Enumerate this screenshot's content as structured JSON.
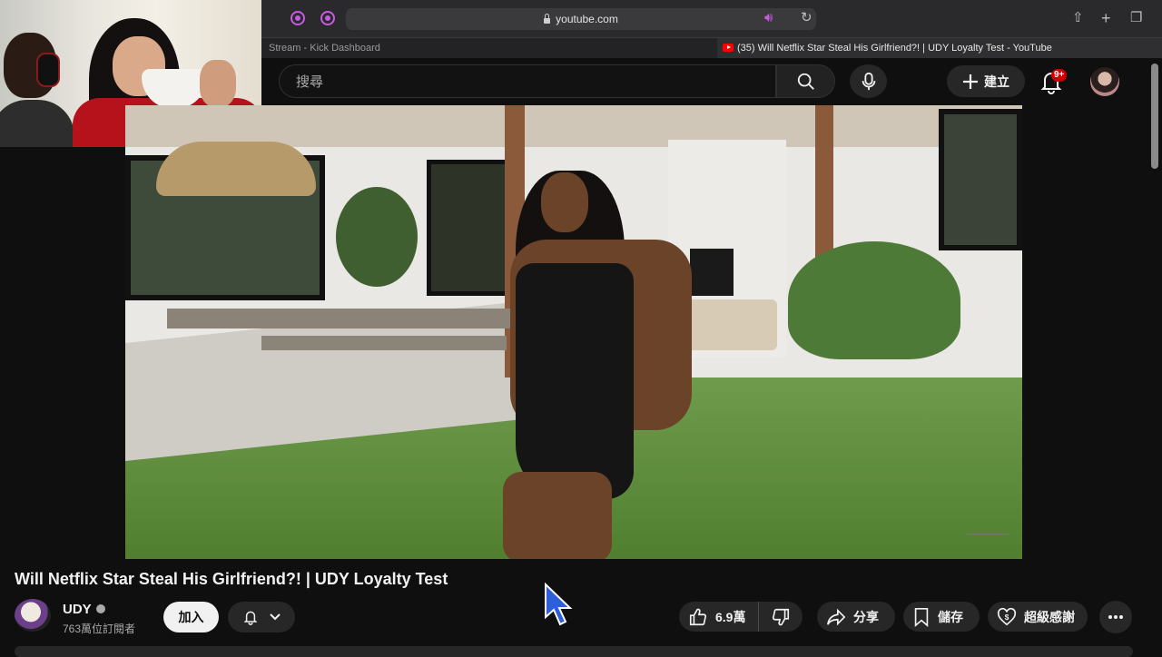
{
  "browser": {
    "url": "youtube.com",
    "tabs": [
      {
        "title": "Stream - Kick Dashboard",
        "active": false
      },
      {
        "title": "(35) Will Netflix Star Steal His Girlfriend?! | UDY Loyalty Test - YouTube",
        "active": true
      }
    ],
    "accent_color": "#c75ae0"
  },
  "header": {
    "search_placeholder": "搜尋",
    "create_label": "建立",
    "notification_badge": "9+",
    "icons": [
      "search-icon",
      "mic-icon",
      "plus-icon",
      "bell-icon",
      "avatar"
    ]
  },
  "video": {
    "title": "Will Netflix Star Steal His Girlfriend?! | UDY Loyalty Test"
  },
  "channel": {
    "name": "UDY",
    "subscribers": "763萬位訂閱者",
    "join_label": "加入"
  },
  "actions": {
    "likes": "6.9萬",
    "share_label": "分享",
    "save_label": "儲存",
    "thanks_label": "超級感謝"
  },
  "colors": {
    "youtube_red": "#ff0000",
    "background": "#0f0f0f",
    "button_bg": "#272727"
  }
}
